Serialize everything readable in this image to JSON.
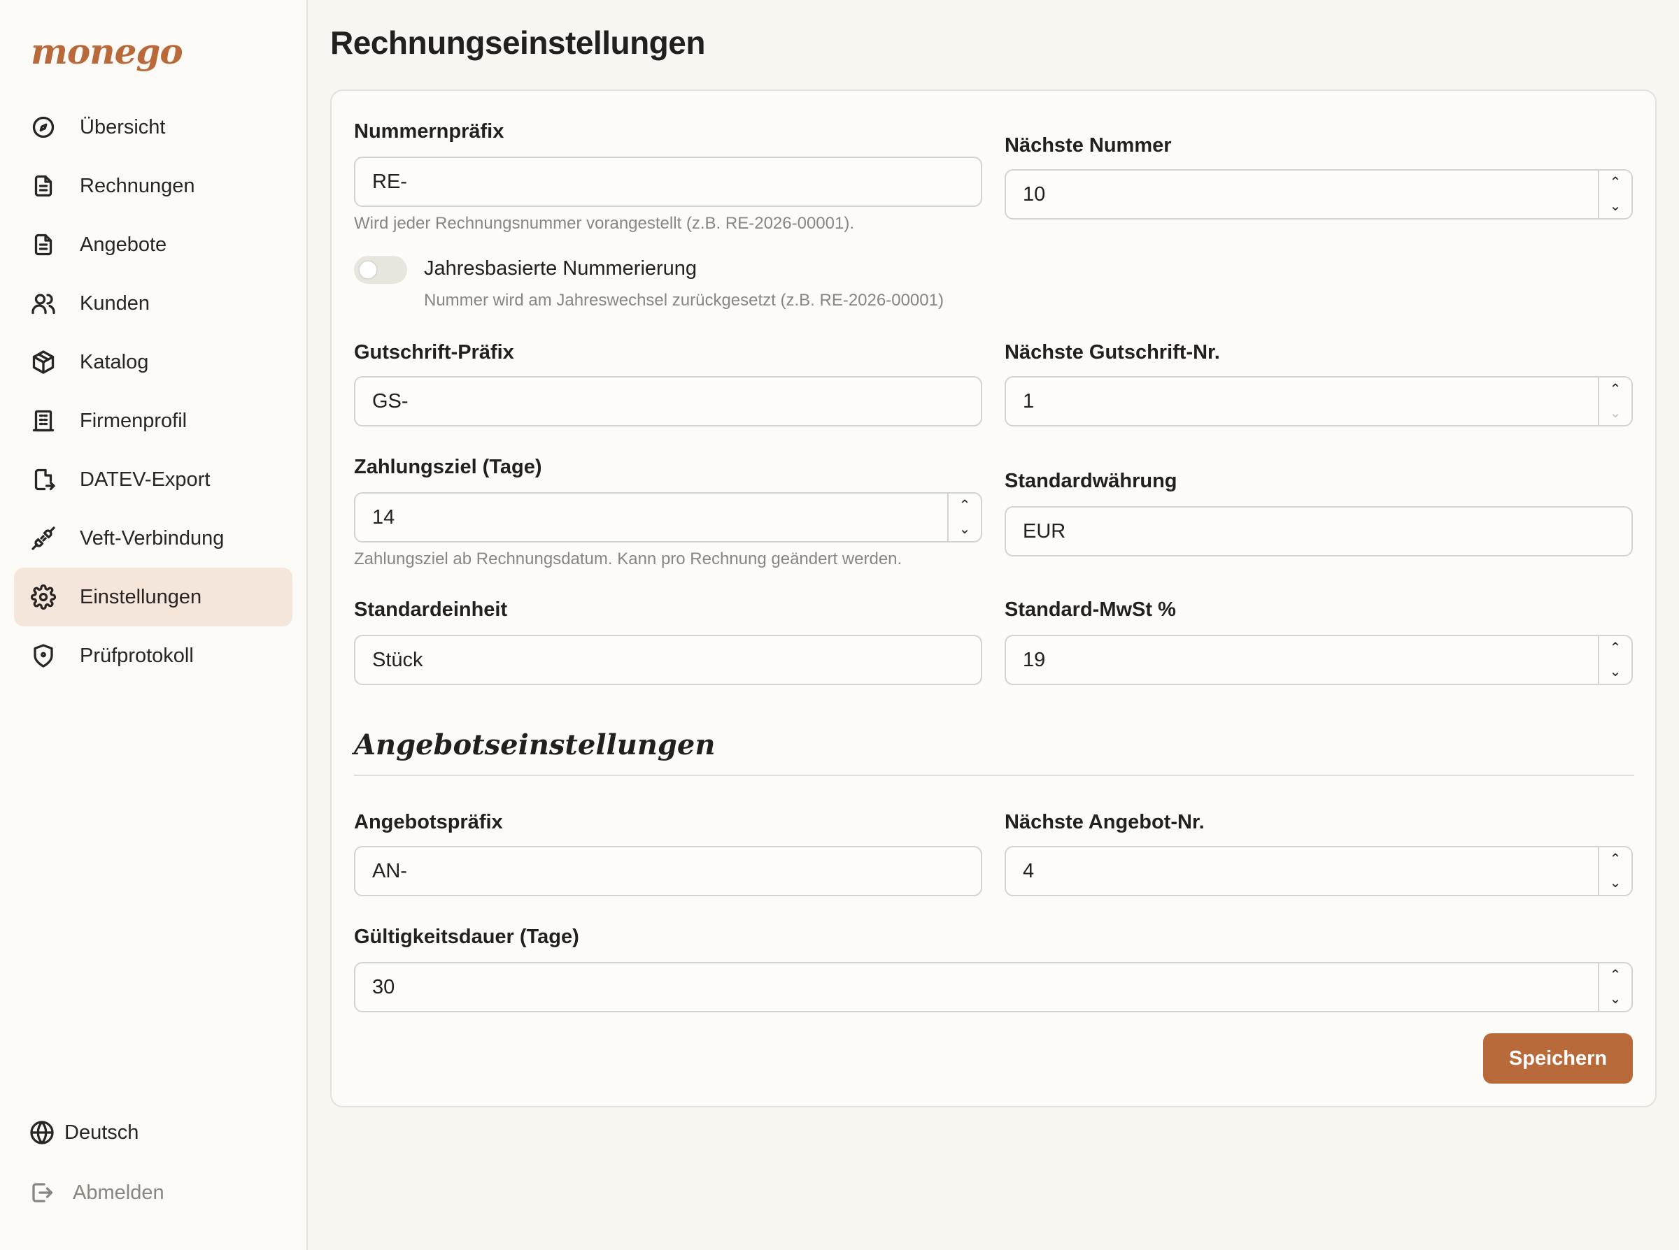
{
  "brand": {
    "logo": "monego",
    "accent": "#b86a3b"
  },
  "sidebar": {
    "items": [
      {
        "label": "Übersicht",
        "icon": "dashboard-gauge-icon",
        "active": false
      },
      {
        "label": "Rechnungen",
        "icon": "document-icon",
        "active": false
      },
      {
        "label": "Angebote",
        "icon": "document-icon",
        "active": false
      },
      {
        "label": "Kunden",
        "icon": "users-icon",
        "active": false
      },
      {
        "label": "Katalog",
        "icon": "package-icon",
        "active": false
      },
      {
        "label": "Firmenprofil",
        "icon": "building-icon",
        "active": false
      },
      {
        "label": "DATEV-Export",
        "icon": "file-export-icon",
        "active": false
      },
      {
        "label": "Veft-Verbindung",
        "icon": "plug-icon",
        "active": false
      },
      {
        "label": "Einstellungen",
        "icon": "gear-icon",
        "active": true
      },
      {
        "label": "Prüfprotokoll",
        "icon": "shield-icon",
        "active": false
      }
    ],
    "language": "Deutsch",
    "logout": "Abmelden"
  },
  "page": {
    "title": "Rechnungseinstellungen"
  },
  "invoice": {
    "prefix": {
      "label": "Nummernpräfix",
      "value": "RE-",
      "hint": "Wird jeder Rechnungsnummer vorangestellt (z.B. RE-2026-00001)."
    },
    "next_number": {
      "label": "Nächste Nummer",
      "value": "10"
    },
    "yearly": {
      "label": "Jahresbasierte Nummerierung",
      "hint": "Nummer wird am Jahreswechsel zurückgesetzt (z.B. RE-2026-00001)",
      "enabled": false
    },
    "credit_prefix": {
      "label": "Gutschrift-Präfix",
      "value": "GS-"
    },
    "next_credit": {
      "label": "Nächste Gutschrift-Nr.",
      "value": "1"
    },
    "payment_term": {
      "label": "Zahlungsziel (Tage)",
      "value": "14",
      "hint": "Zahlungsziel ab Rechnungsdatum. Kann pro Rechnung geändert werden."
    },
    "currency": {
      "label": "Standardwährung",
      "value": "EUR"
    },
    "unit": {
      "label": "Standardeinheit",
      "value": "Stück"
    },
    "vat": {
      "label": "Standard-MwSt %",
      "value": "19"
    }
  },
  "quotes": {
    "section_title": "Angebotseinstellungen",
    "prefix": {
      "label": "Angebotspräfix",
      "value": "AN-"
    },
    "next_number": {
      "label": "Nächste Angebot-Nr.",
      "value": "4"
    },
    "validity": {
      "label": "Gültigkeitsdauer (Tage)",
      "value": "30"
    }
  },
  "actions": {
    "save": "Speichern"
  }
}
